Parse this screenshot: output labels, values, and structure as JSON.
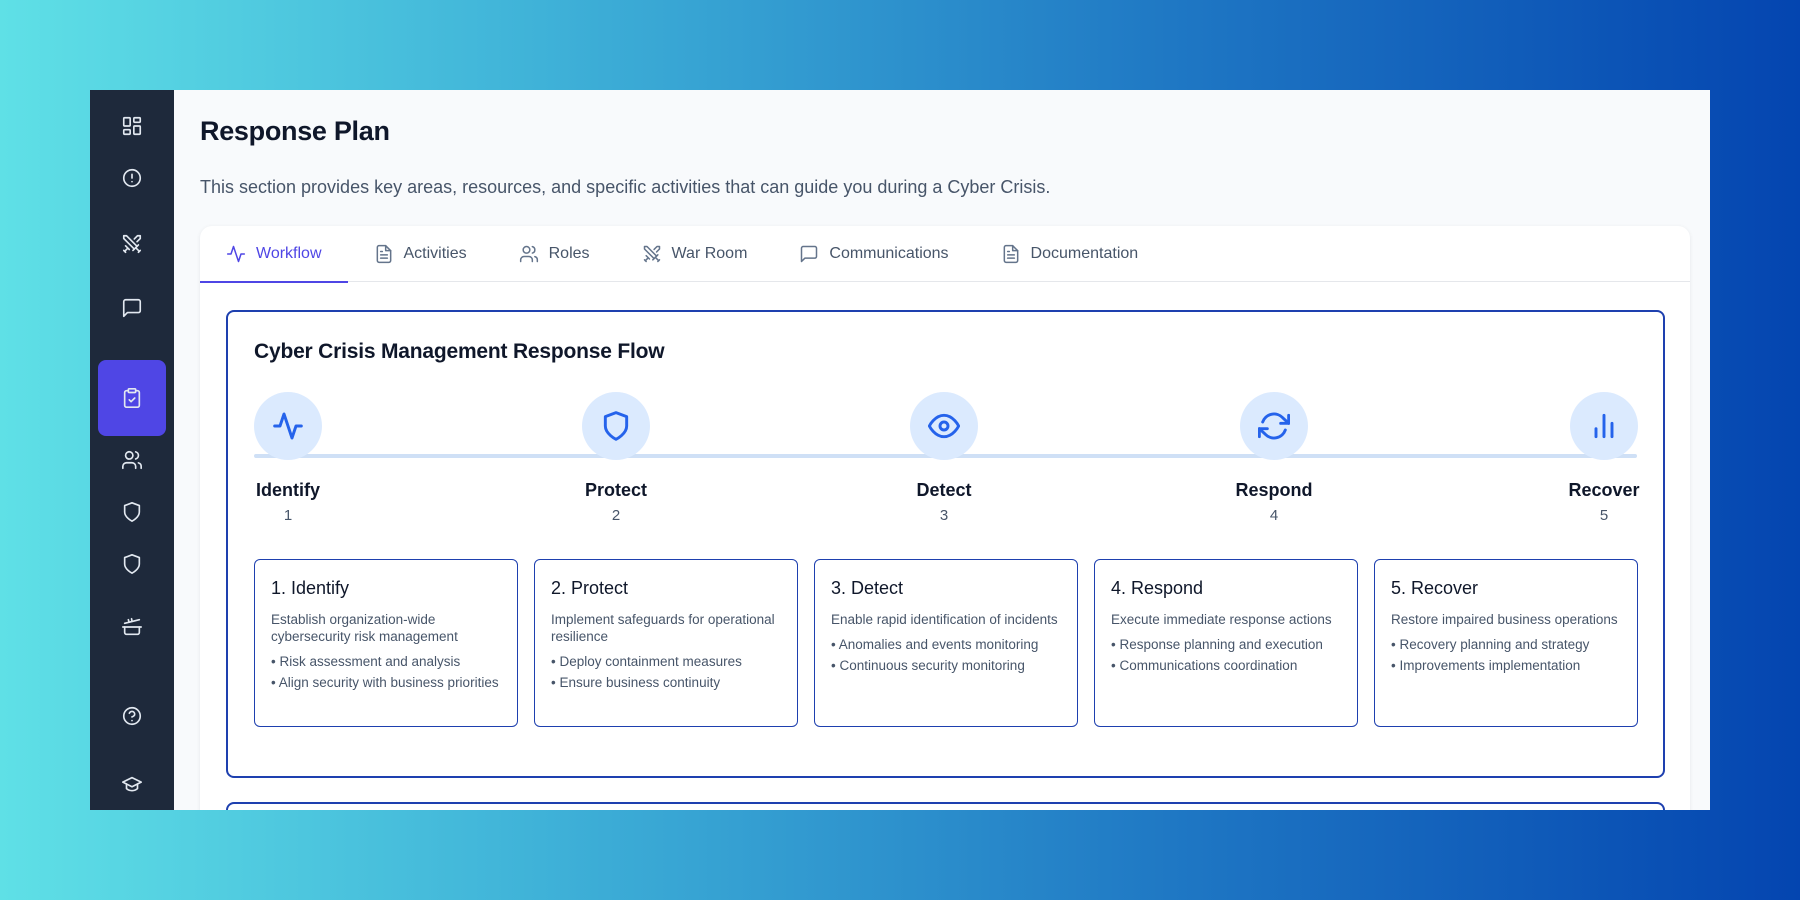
{
  "page": {
    "title": "Response Plan",
    "description": "This section provides key areas, resources, and specific activities that can guide you during a Cyber Crisis."
  },
  "sidebar": {
    "items": [
      {
        "icon": "dashboard-icon"
      },
      {
        "icon": "alert-circle-icon"
      },
      {
        "icon": "swords-icon"
      },
      {
        "icon": "message-icon"
      },
      {
        "icon": "clipboard-check-icon",
        "active": true
      },
      {
        "icon": "users-icon"
      },
      {
        "icon": "shield-icon"
      },
      {
        "icon": "shield-icon"
      },
      {
        "icon": "cooking-pot-icon"
      },
      {
        "icon": "help-circle-icon"
      },
      {
        "icon": "graduation-cap-icon"
      }
    ]
  },
  "tabs": [
    {
      "label": "Workflow",
      "icon": "activity-icon",
      "active": true
    },
    {
      "label": "Activities",
      "icon": "file-text-icon"
    },
    {
      "label": "Roles",
      "icon": "users-icon"
    },
    {
      "label": "War Room",
      "icon": "swords-icon"
    },
    {
      "label": "Communications",
      "icon": "message-icon"
    },
    {
      "label": "Documentation",
      "icon": "file-text-icon"
    }
  ],
  "flow": {
    "title": "Cyber Crisis Management Response Flow",
    "steps": [
      {
        "name": "Identify",
        "number": "1",
        "icon": "activity-icon"
      },
      {
        "name": "Protect",
        "number": "2",
        "icon": "shield-icon"
      },
      {
        "name": "Detect",
        "number": "3",
        "icon": "eye-icon"
      },
      {
        "name": "Respond",
        "number": "4",
        "icon": "refresh-icon"
      },
      {
        "name": "Recover",
        "number": "5",
        "icon": "bar-chart-icon"
      }
    ],
    "details": [
      {
        "title": "1. Identify",
        "description": "Establish organization-wide cybersecurity risk management",
        "bullets": [
          "Risk assessment and analysis",
          "Align security with business priorities"
        ]
      },
      {
        "title": "2. Protect",
        "description": "Implement safeguards for operational resilience",
        "bullets": [
          "Deploy containment measures",
          "Ensure business continuity"
        ]
      },
      {
        "title": "3. Detect",
        "description": "Enable rapid identification of incidents",
        "bullets": [
          "Anomalies and events monitoring",
          "Continuous security monitoring"
        ]
      },
      {
        "title": "4. Respond",
        "description": "Execute immediate response actions",
        "bullets": [
          "Response planning and execution",
          "Communications coordination"
        ]
      },
      {
        "title": "5. Recover",
        "description": "Restore impaired business operations",
        "bullets": [
          "Recovery planning and strategy",
          "Improvements implementation"
        ]
      }
    ]
  },
  "colors": {
    "accent": "#4f46e5",
    "sidebar": "#1e293b",
    "flow_border": "#1e40af",
    "step_circle": "#dbeafe",
    "icon_blue": "#2563eb"
  }
}
